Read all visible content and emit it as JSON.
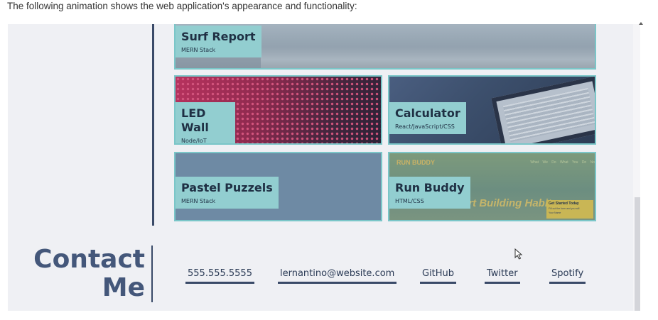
{
  "intro_text": "The following animation shows the web application's appearance and functionality:",
  "projects": [
    {
      "name": "Surf Report",
      "tech": "MERN Stack"
    },
    {
      "name": "LED Wall",
      "tech": "Node/IoT"
    },
    {
      "name": "Calculator",
      "tech": "React/JavaScript/CSS"
    },
    {
      "name": "Pastel Puzzels",
      "tech": "MERN Stack"
    },
    {
      "name": "Run Buddy",
      "tech": "HTML/CSS",
      "preview": {
        "brand": "RUN BUDDY",
        "nav": "What We Do What You Do No",
        "hero": "tart Building Habits",
        "cta_title": "Get Started Today",
        "cta_sub": "Fill out the form and you will",
        "cta_field": "Your Name"
      }
    }
  ],
  "contact": {
    "title_line1": "Contact",
    "title_line2": "Me",
    "links": [
      "555.555.5555",
      "lernantino@website.com",
      "GitHub",
      "Twitter",
      "Spotify"
    ]
  },
  "colors": {
    "accent": "#7ac6c8",
    "label_bg": "#92ced0",
    "primary_dark": "#3a4a68",
    "title": "#44577a",
    "background": "#eff0f4"
  },
  "icons": [
    "pointer-cursor-icon",
    "scroll-up-arrow-icon"
  ]
}
